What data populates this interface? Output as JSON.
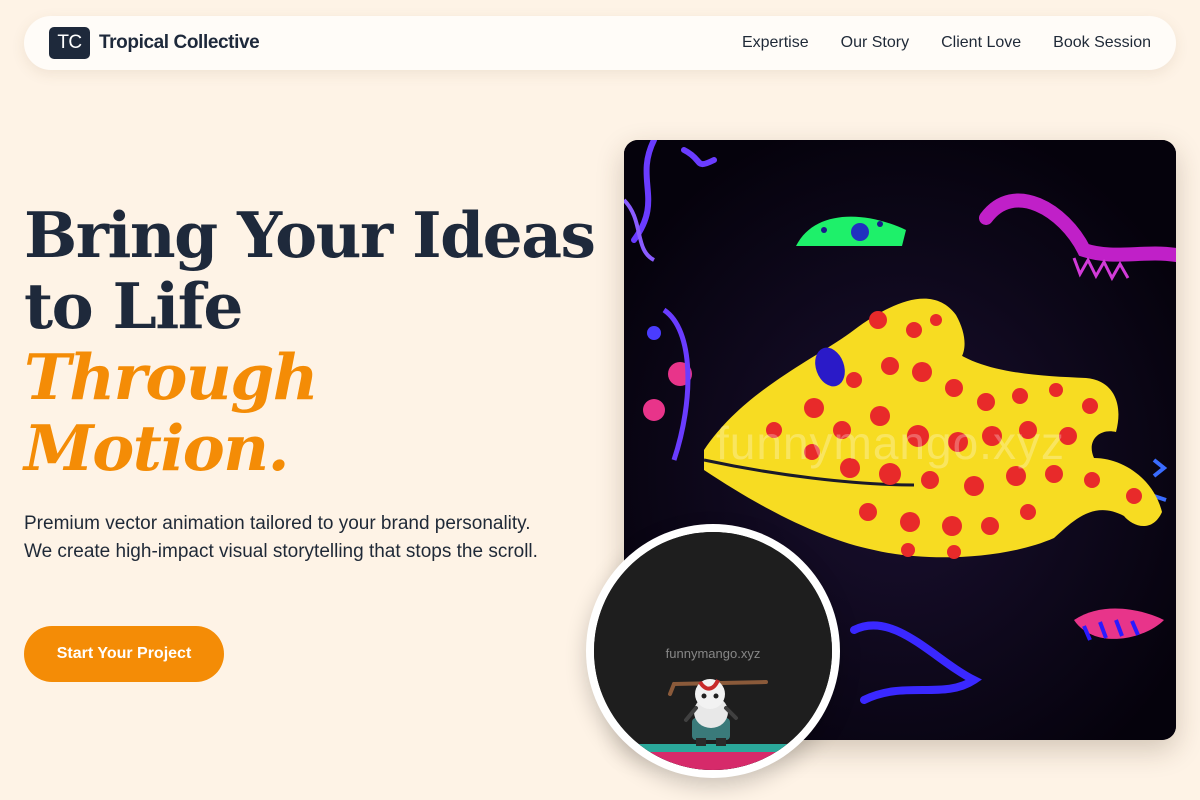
{
  "brand": {
    "mark": "TC",
    "name": "Tropical Collective"
  },
  "nav": {
    "links": [
      "Expertise",
      "Our Story",
      "Client Love",
      "Book Session"
    ]
  },
  "hero": {
    "title_line1": "Bring Your Ideas",
    "title_line2": "to Life",
    "title_accent_line1": "Through",
    "title_accent_line2": "Motion.",
    "description": "Premium vector animation tailored to your brand personality. We create high-impact visual storytelling that stops the scroll.",
    "cta_label": "Start Your Project"
  },
  "media": {
    "main_watermark": "funnymango.xyz",
    "thumb_watermark": "funnymango.xyz"
  },
  "colors": {
    "background": "#fef3e6",
    "navy": "#1e293b",
    "accent_orange": "#f48c06"
  }
}
